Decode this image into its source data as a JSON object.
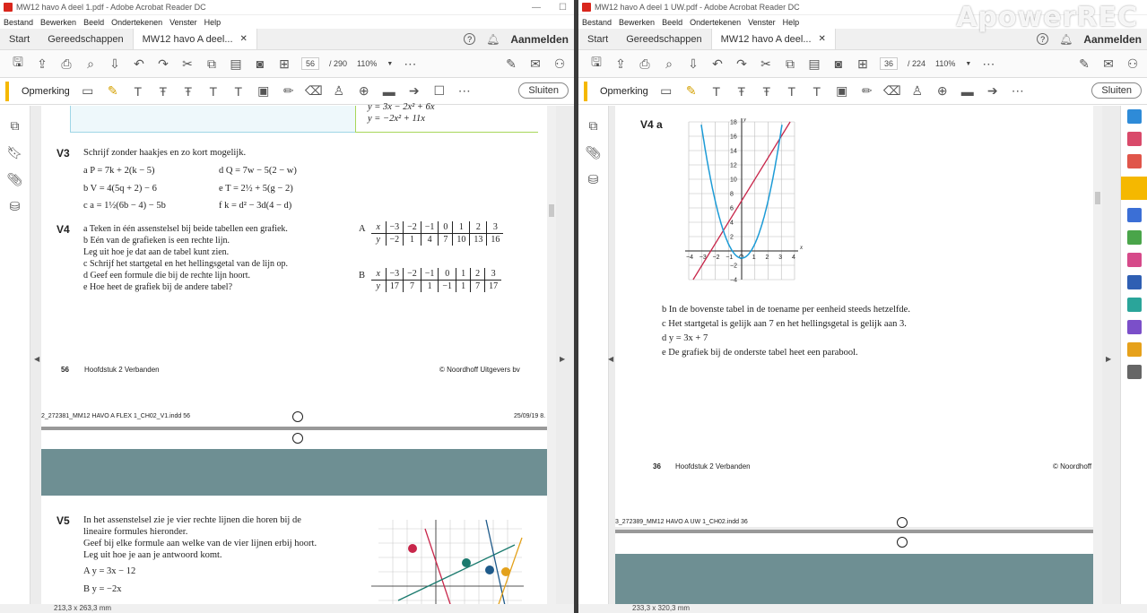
{
  "left": {
    "title": "MW12 havo A deel 1.pdf - Adobe Acrobat Reader DC",
    "menu": [
      "Bestand",
      "Bewerken",
      "Beeld",
      "Ondertekenen",
      "Venster",
      "Help"
    ],
    "tabs": [
      "Start",
      "Gereedschappen",
      "MW12 havo A deel..."
    ],
    "signin": "Aanmelden",
    "page_current": "56",
    "page_total": "/ 290",
    "zoom": "110%",
    "ann_label": "Opmerking",
    "close_label": "Sluiten",
    "top_formula1": "y = 3x − 2x² + 6x",
    "top_formula2": "y = −2x² + 11x",
    "v3": {
      "num": "V3",
      "intro": "Schrijf zonder haakjes en zo kort mogelijk.",
      "items": [
        "a   P = 7k + 2(k − 5)",
        "b   V = 4(5q + 2) − 6",
        "c   a = 1½(6b − 4) − 5b",
        "d   Q = 7w − 5(2 − w)",
        "e   T = 2½ + 5(g − 2)",
        "f   k = d² − 3d(4 − d)"
      ]
    },
    "v4": {
      "num": "V4",
      "items": [
        "a   Teken in één assenstelsel bij beide tabellen een grafiek.",
        "b   Eén van de grafieken is een rechte lijn.",
        "     Leg uit hoe je dat aan de tabel kunt zien.",
        "c   Schrijf het startgetal en het hellingsgetal van de lijn op.",
        "d   Geef een formule die bij de rechte lijn hoort.",
        "e   Hoe heet de grafiek bij de andere tabel?"
      ],
      "tableA_label": "A",
      "tableA_x": [
        "x",
        "−3",
        "−2",
        "−1",
        "0",
        "1",
        "2",
        "3"
      ],
      "tableA_y": [
        "y",
        "−2",
        "1",
        "4",
        "7",
        "10",
        "13",
        "16"
      ],
      "tableB_label": "B",
      "tableB_x": [
        "x",
        "−3",
        "−2",
        "−1",
        "0",
        "1",
        "2",
        "3"
      ],
      "tableB_y": [
        "y",
        "17",
        "7",
        "1",
        "−1",
        "1",
        "7",
        "17"
      ]
    },
    "footer_page": "56",
    "footer_chapter": "Hoofdstuk 2 Verbanden",
    "footer_copy": "© Noordhoff Uitgevers bv",
    "slug_left": "2_272381_MM12 HAVO A FLEX 1_CH02_V1.indd   56",
    "slug_right": "25/09/19   8.",
    "v5": {
      "num": "V5",
      "lines": [
        "In het assenstelsel zie je vier rechte lijnen die horen bij de",
        "lineaire formules hieronder.",
        "Geef bij elke formule aan welke van de vier lijnen erbij hoort.",
        "Leg uit hoe je aan je antwoord komt."
      ],
      "formulas": [
        "A   y = 3x − 12",
        "B   y = −2x"
      ]
    },
    "status_size": "213,3 x 263,3 mm"
  },
  "right": {
    "title": "MW12 havo A deel 1 UW.pdf - Adobe Acrobat Reader DC",
    "menu": [
      "Bestand",
      "Bewerken",
      "Beeld",
      "Ondertekenen",
      "Venster",
      "Help"
    ],
    "tabs": [
      "Start",
      "Gereedschappen",
      "MW12 havo A deel..."
    ],
    "signin": "Aanmelden",
    "page_current": "36",
    "page_total": "/ 224",
    "zoom": "110%",
    "ann_label": "Opmerking",
    "close_label": "Sluiten",
    "v4_label": "V4  a",
    "answers": [
      "b   In de bovenste tabel in de toename per eenheid steeds hetzelfde.",
      "c   Het startgetal is gelijk aan 7 en het hellingsgetal is gelijk aan 3.",
      "d   y = 3x + 7",
      "e   De grafiek bij de onderste tabel heet een parabool."
    ],
    "footer_page": "36",
    "footer_chapter": "Hoofdstuk 2 Verbanden",
    "footer_copy": "© Noordhoff",
    "slug_left": "3_272389_MM12 HAVO A UW 1_CH02.indd   36",
    "status_size": "233,3 x 320,3 mm",
    "watermark": "ApowerREC"
  },
  "colors": {
    "accent_yellow": "#f5b800",
    "teal_band": "#6e8f93",
    "line_red": "#c8264a"
  },
  "chart_data": {
    "type": "line",
    "xlim": [
      -4,
      4
    ],
    "ylim": [
      -4,
      18
    ],
    "x_ticks": [
      "−4",
      "−3",
      "−2",
      "−1",
      "O",
      "1",
      "2",
      "3",
      "4"
    ],
    "y_ticks": [
      "18",
      "16",
      "14",
      "12",
      "10",
      "8",
      "6",
      "4",
      "2",
      "−2",
      "−4"
    ],
    "xlabel": "x",
    "ylabel": "y",
    "series": [
      {
        "x": [
          -3,
          -2,
          -1,
          0,
          1,
          2,
          3
        ],
        "y": [
          -2,
          1,
          4,
          7,
          10,
          13,
          16
        ]
      },
      {
        "x": [
          -3,
          -2,
          -1,
          0,
          1,
          2,
          3
        ],
        "y": [
          17,
          7,
          1,
          -1,
          1,
          7,
          17
        ]
      }
    ]
  }
}
